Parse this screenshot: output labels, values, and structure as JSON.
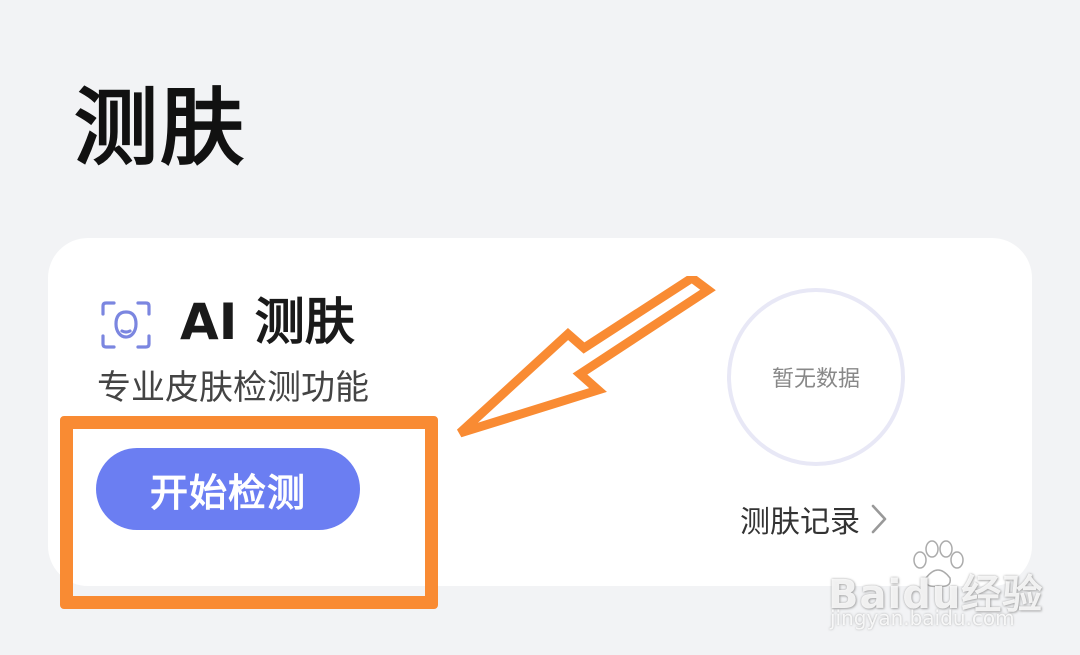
{
  "page": {
    "title": "测肤"
  },
  "card": {
    "icon": "face-scan-icon",
    "title": "AI 测肤",
    "subtitle": "专业皮肤检测功能",
    "start_button_label": "开始检测",
    "score_placeholder": "暂无数据",
    "history_link_label": "测肤记录"
  },
  "annotation": {
    "highlight_color": "#f98b33",
    "arrow_color": "#f98b33"
  },
  "watermark": {
    "logo_text": "Baidu经验",
    "url": "jingyan.baidu.com"
  },
  "colors": {
    "accent": "#6b7ef2",
    "background": "#f2f3f5",
    "card": "#ffffff"
  }
}
